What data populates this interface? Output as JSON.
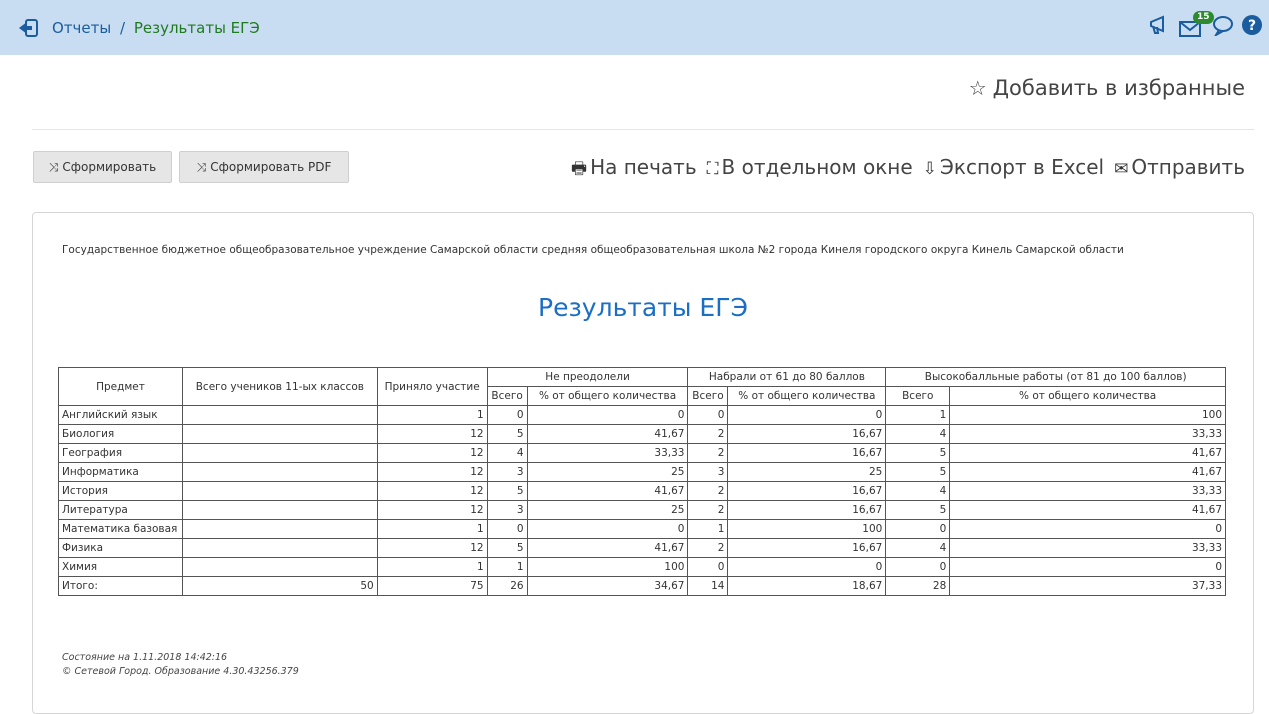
{
  "breadcrumb": {
    "parent": "Отчеты",
    "separator": "/",
    "current": "Результаты ЕГЭ"
  },
  "top_icons": {
    "messages_count": "15"
  },
  "favorites": {
    "label": "Добавить в избранные"
  },
  "buttons": {
    "generate": "Сформировать",
    "generate_pdf": "Сформировать PDF"
  },
  "actions": {
    "print": "На печать",
    "window": "В отдельном окне",
    "excel": "Экспорт в Excel",
    "send": "Отправить"
  },
  "report": {
    "organization": "Государственное бюджетное общеобразовательное учреждение Самарской области средняя общеобразовательная школа №2 города Кинеля городского округа Кинель Самарской области",
    "title": "Результаты ЕГЭ",
    "headers": {
      "subject": "Предмет",
      "total_students": "Всего учеников 11-ых классов",
      "participated": "Приняло участие",
      "not_passed": "Не преодолели",
      "mid": "Набрали от 61 до 80 баллов",
      "high": "Высокобалльные работы (от 81 до 100 баллов)",
      "total": "Всего",
      "percent": "% от общего количества"
    },
    "rows": [
      [
        "Английский язык",
        "",
        "1",
        "0",
        "0",
        "0",
        "0",
        "1",
        "100"
      ],
      [
        "Биология",
        "",
        "12",
        "5",
        "41,67",
        "2",
        "16,67",
        "4",
        "33,33"
      ],
      [
        "География",
        "",
        "12",
        "4",
        "33,33",
        "2",
        "16,67",
        "5",
        "41,67"
      ],
      [
        "Информатика",
        "",
        "12",
        "3",
        "25",
        "3",
        "25",
        "5",
        "41,67"
      ],
      [
        "История",
        "",
        "12",
        "5",
        "41,67",
        "2",
        "16,67",
        "4",
        "33,33"
      ],
      [
        "Литература",
        "",
        "12",
        "3",
        "25",
        "2",
        "16,67",
        "5",
        "41,67"
      ],
      [
        "Математика базовая",
        "",
        "1",
        "0",
        "0",
        "1",
        "100",
        "0",
        "0"
      ],
      [
        "Физика",
        "",
        "12",
        "5",
        "41,67",
        "2",
        "16,67",
        "4",
        "33,33"
      ],
      [
        "Химия",
        "",
        "1",
        "1",
        "100",
        "0",
        "0",
        "0",
        "0"
      ],
      [
        "Итого:",
        "50",
        "75",
        "26",
        "34,67",
        "14",
        "18,67",
        "28",
        "37,33"
      ]
    ],
    "footer_status": "Состояние на 1.11.2018 14:42:16",
    "footer_copyright": "© Сетевой Город. Образование 4.30.43256.379"
  }
}
